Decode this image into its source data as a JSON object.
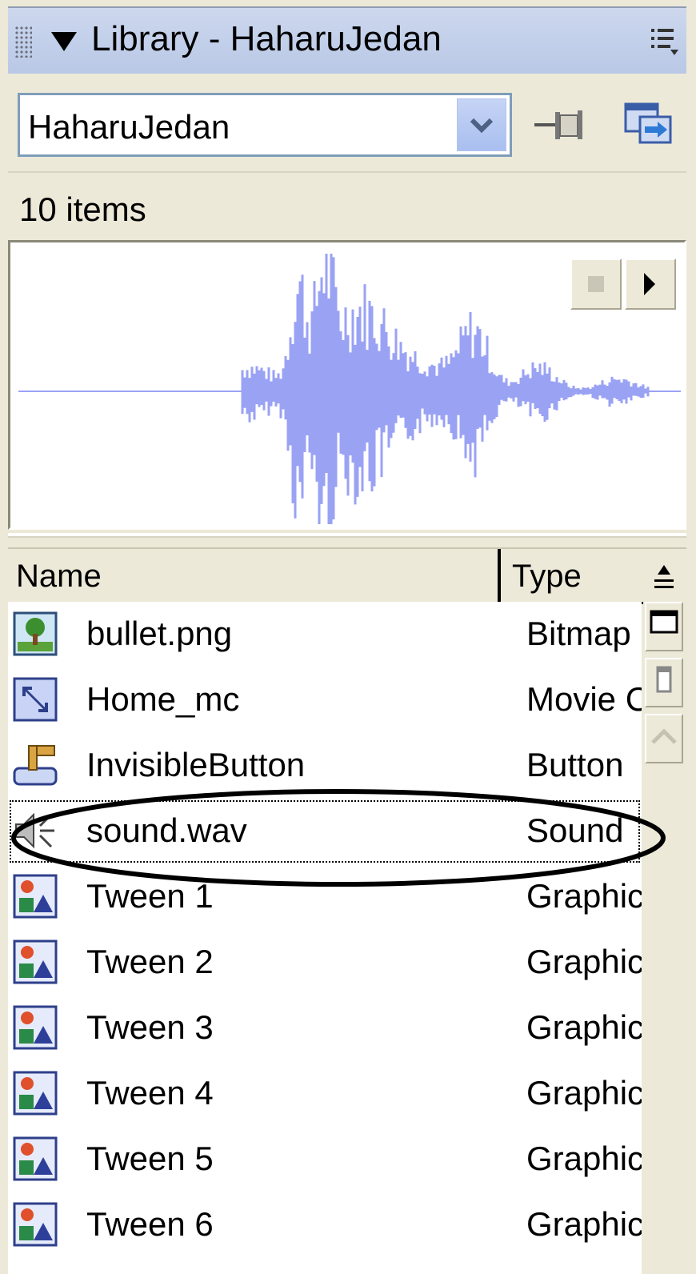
{
  "panel": {
    "title": "Library - HaharuJedan",
    "menu_icon": "options-menu-icon"
  },
  "selector": {
    "value": "HaharuJedan",
    "pin_icon": "pin-icon",
    "new_library_icon": "new-library-panel-icon"
  },
  "count": "10 items",
  "preview": {
    "kind": "sound waveform",
    "stop_icon": "stop-icon",
    "play_icon": "play-icon",
    "waveform_color": "#9aa2f4"
  },
  "columns": {
    "name": "Name",
    "type": "Type"
  },
  "items": [
    {
      "name": "bullet.png",
      "type": "Bitmap",
      "icon": "bitmap-icon"
    },
    {
      "name": "Home_mc",
      "type": "Movie C",
      "icon": "movieclip-icon"
    },
    {
      "name": "InvisibleButton",
      "type": "Button",
      "icon": "button-icon"
    },
    {
      "name": "sound.wav",
      "type": "Sound",
      "icon": "sound-icon"
    },
    {
      "name": "Tween 1",
      "type": "Graphic",
      "icon": "graphic-icon"
    },
    {
      "name": "Tween 2",
      "type": "Graphic",
      "icon": "graphic-icon"
    },
    {
      "name": "Tween 3",
      "type": "Graphic",
      "icon": "graphic-icon"
    },
    {
      "name": "Tween 4",
      "type": "Graphic",
      "icon": "graphic-icon"
    },
    {
      "name": "Tween 5",
      "type": "Graphic",
      "icon": "graphic-icon"
    },
    {
      "name": "Tween 6",
      "type": "Graphic",
      "icon": "graphic-icon"
    }
  ],
  "selected_item": "sound.wav",
  "colors": {
    "title_bar": "#c3d0ea",
    "panel_bg": "#ece9d8",
    "select_border": "#7f9db9",
    "highlight_ellipse": "#000000"
  }
}
